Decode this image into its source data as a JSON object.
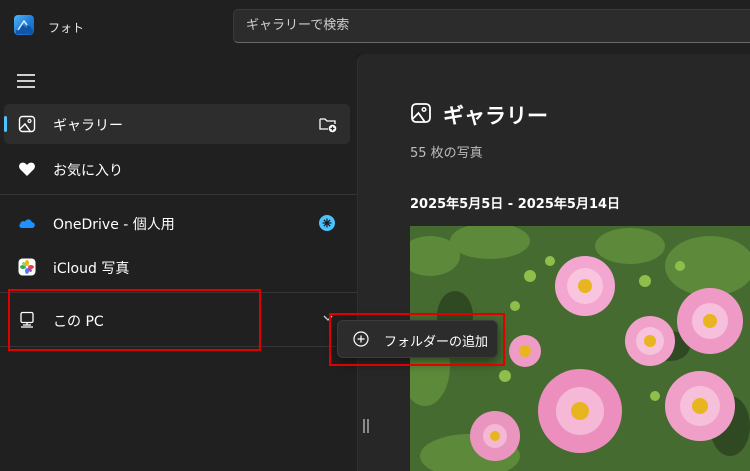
{
  "app": {
    "title": "フォト"
  },
  "search": {
    "placeholder": "ギャラリーで検索"
  },
  "sidebar": {
    "items": [
      {
        "label": "ギャラリー"
      },
      {
        "label": "お気に入り"
      },
      {
        "label": "OneDrive - 個人用"
      },
      {
        "label": "iCloud 写真"
      },
      {
        "label": "この PC"
      }
    ]
  },
  "flyout": {
    "add_folder_label": "フォルダーの追加"
  },
  "main": {
    "title": "ギャラリー",
    "photo_count": "55 枚の写真",
    "date_range": "2025年5月5日 - 2025年5月14日"
  },
  "colors": {
    "accent": "#4cc2ff",
    "highlight": "#e00000",
    "onedrive": "#1e90ff"
  }
}
